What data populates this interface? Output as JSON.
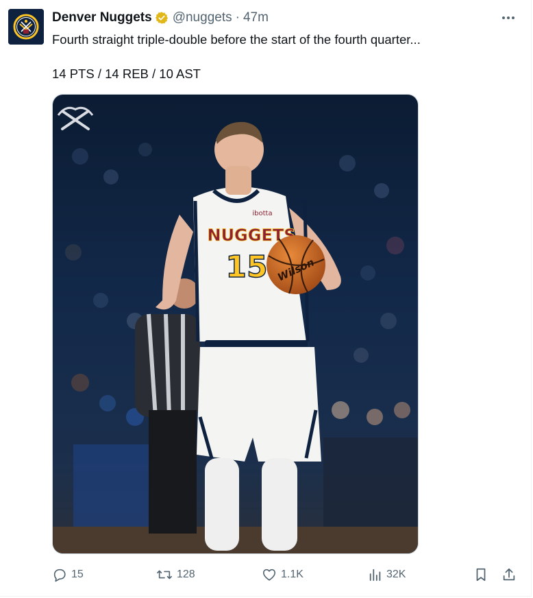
{
  "author": {
    "display_name": "Denver Nuggets",
    "handle": "@nuggets",
    "separator": "·",
    "time": "47m",
    "verified_badge_color": "#e2b719"
  },
  "tweet": {
    "text": "Fourth straight triple-double before the start of the fourth quarter...",
    "stats_line": "14 PTS / 14 REB / 10 AST"
  },
  "media": {
    "jersey_team": "NUGGETS",
    "jersey_number": "15",
    "jersey_sponsor": "ibotta",
    "ball_brand": "Wilson"
  },
  "actions": {
    "replies": "15",
    "reposts": "128",
    "likes": "1.1K",
    "views": "32K"
  },
  "icons": {
    "avatar": "nuggets-logo-icon",
    "verified": "verified-badge-icon",
    "more": "more-options-icon",
    "reply": "reply-icon",
    "repost": "repost-icon",
    "like": "like-icon",
    "views": "views-icon",
    "bookmark": "bookmark-icon",
    "share": "share-icon"
  },
  "colors": {
    "text_primary": "#0f1419",
    "text_secondary": "#536471",
    "nuggets_navy": "#0e2240",
    "nuggets_gold": "#fec524",
    "nuggets_red": "#8b2131"
  }
}
